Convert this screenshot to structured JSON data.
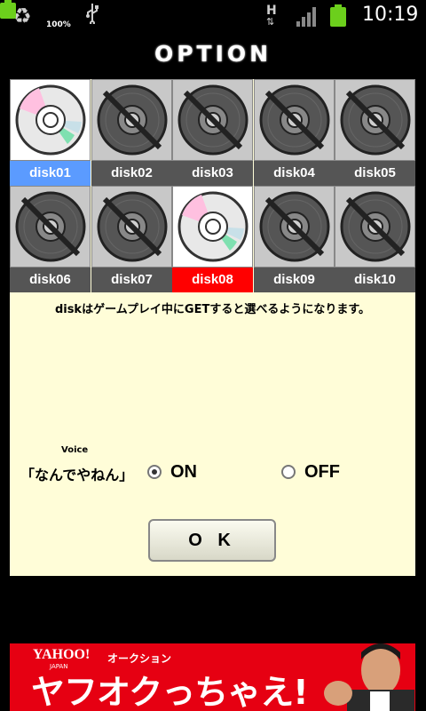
{
  "status_bar": {
    "battery_percent": "100%",
    "network_type": "H",
    "clock": "10:19",
    "icons": [
      "recycle-icon",
      "battery-icon",
      "usb-icon",
      "hspa-icon",
      "signal-icon",
      "battery-icon"
    ]
  },
  "title": "OPTION",
  "disks": [
    {
      "label": "disk01",
      "unlocked": true,
      "selected": "blue"
    },
    {
      "label": "disk02",
      "unlocked": false
    },
    {
      "label": "disk03",
      "unlocked": false
    },
    {
      "label": "disk04",
      "unlocked": false
    },
    {
      "label": "disk05",
      "unlocked": false
    },
    {
      "label": "disk06",
      "unlocked": false
    },
    {
      "label": "disk07",
      "unlocked": false
    },
    {
      "label": "disk08",
      "unlocked": true,
      "selected": "red"
    },
    {
      "label": "disk09",
      "unlocked": false
    },
    {
      "label": "disk10",
      "unlocked": false
    }
  ],
  "note": "diskはゲームプレイ中にGETすると選べるようになります。",
  "voice": {
    "label": "Voice",
    "phrase": "「なんでやねん」",
    "on_label": "ON",
    "off_label": "OFF",
    "selected": "on"
  },
  "ok_label": "O K",
  "ad": {
    "brand": "YAHOO!",
    "brand_sub": "JAPAN",
    "auction": "オークション",
    "headline": "ヤフオクっちゃえ!"
  }
}
